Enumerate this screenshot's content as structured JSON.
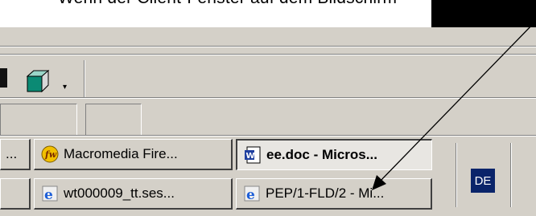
{
  "top_text": "Wenn der Client-Fenster auf dem Bildschirm",
  "toolbar": {
    "dropdown_glyph": "▾"
  },
  "taskbar": {
    "row1": [
      {
        "label": "...",
        "icon": "app-icon"
      },
      {
        "label": "Macromedia Fire...",
        "icon": "fireworks-icon"
      },
      {
        "label": "ee.doc - Micros...",
        "icon": "word-icon",
        "active": true
      }
    ],
    "row2": [
      {
        "label": "",
        "icon": ""
      },
      {
        "label": "wt000009_tt.ses...",
        "icon": "ie-icon"
      },
      {
        "label": "PEP/1-FLD/2 - Mi...",
        "icon": "ie-icon"
      }
    ],
    "language_indicator": "DE"
  },
  "colors": {
    "panel": "#d4d0c8",
    "lang_bg": "#0a246a"
  }
}
